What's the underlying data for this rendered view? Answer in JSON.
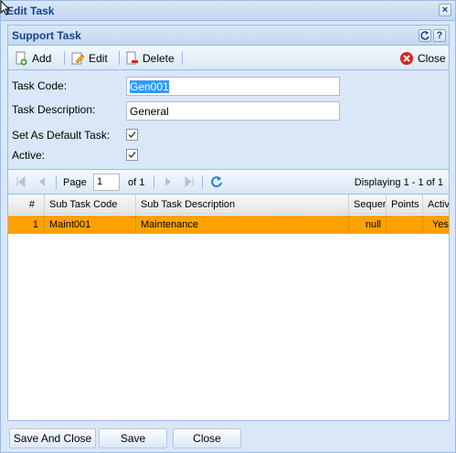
{
  "window": {
    "title": "Edit Task"
  },
  "panel": {
    "title": "Support Task"
  },
  "toolbar": {
    "add_label": "Add",
    "edit_label": "Edit",
    "delete_label": "Delete",
    "close_label": "Close"
  },
  "form": {
    "task_code_label": "Task Code:",
    "task_code_value": "Gen001",
    "task_description_label": "Task Description:",
    "task_description_value": "General",
    "default_task_label": "Set As Default Task:",
    "default_task_checked": true,
    "active_label": "Active:",
    "active_checked": true
  },
  "pager": {
    "page_label": "Page",
    "page_value": "1",
    "of_label": "of 1",
    "displaying": "Displaying 1 - 1 of 1"
  },
  "grid": {
    "columns": [
      "#",
      "Sub Task Code",
      "Sub Task Description",
      "Sequer",
      "Points",
      "Activ"
    ],
    "rows": [
      {
        "num": "1",
        "code": "Maint001",
        "description": "Maintenance",
        "sequence": "null",
        "points": "",
        "active": "Yes"
      }
    ]
  },
  "footer": {
    "save_close_label": "Save And Close",
    "save_label": "Save",
    "close_label": "Close"
  },
  "colors": {
    "header_text": "#15428b",
    "selected_row": "#ffa200",
    "panel_bg": "#d9e7f8"
  }
}
